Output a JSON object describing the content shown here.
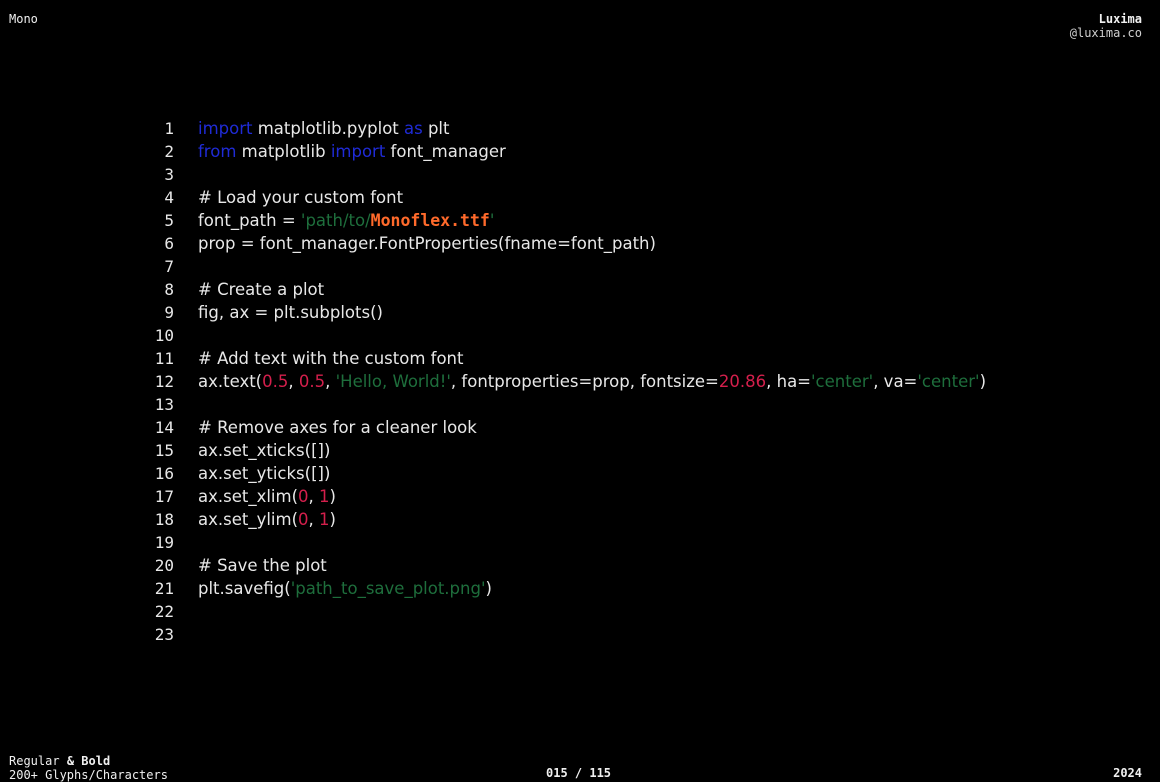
{
  "header": {
    "left": "Mono",
    "brand": "Luxima",
    "handle": "@luxima.co"
  },
  "footer": {
    "weights_regular": "Regular",
    "weights_amp": "&",
    "weights_bold": "Bold",
    "glyphs": "200+ Glyphs/Characters",
    "page": "015 / 115",
    "year": "2024"
  },
  "colors": {
    "background": "#000000",
    "keyword": "#1f2bd6",
    "string": "#1e6e3c",
    "number": "#d41f4c",
    "highlight": "#ff6a2b"
  },
  "code": [
    {
      "n": "1",
      "tokens": [
        {
          "t": "import",
          "k": "keyword"
        },
        {
          "t": " matplotlib.pyplot ",
          "k": "plain"
        },
        {
          "t": "as",
          "k": "keyword"
        },
        {
          "t": " plt",
          "k": "plain"
        }
      ]
    },
    {
      "n": "2",
      "tokens": [
        {
          "t": "from",
          "k": "keyword"
        },
        {
          "t": " matplotlib ",
          "k": "plain"
        },
        {
          "t": "import",
          "k": "keyword"
        },
        {
          "t": " font_manager",
          "k": "plain"
        }
      ]
    },
    {
      "n": "3",
      "tokens": []
    },
    {
      "n": "4",
      "tokens": [
        {
          "t": "# Load your custom font",
          "k": "comment"
        }
      ]
    },
    {
      "n": "5",
      "tokens": [
        {
          "t": "font_path = ",
          "k": "plain"
        },
        {
          "t": "'path/to/",
          "k": "string"
        },
        {
          "t": "Monoflex.ttf",
          "k": "highlight"
        },
        {
          "t": "'",
          "k": "string"
        }
      ]
    },
    {
      "n": "6",
      "tokens": [
        {
          "t": "prop = font_manager.FontProperties(fname=font_path)",
          "k": "plain"
        }
      ]
    },
    {
      "n": "7",
      "tokens": []
    },
    {
      "n": "8",
      "tokens": [
        {
          "t": "# Create a plot",
          "k": "comment"
        }
      ]
    },
    {
      "n": "9",
      "tokens": [
        {
          "t": "fig, ax = plt.subplots()",
          "k": "plain"
        }
      ]
    },
    {
      "n": "10",
      "tokens": []
    },
    {
      "n": "11",
      "tokens": [
        {
          "t": "# Add text with the custom font",
          "k": "comment"
        }
      ]
    },
    {
      "n": "12",
      "tokens": [
        {
          "t": "ax.text(",
          "k": "plain"
        },
        {
          "t": "0.5",
          "k": "number"
        },
        {
          "t": ", ",
          "k": "plain"
        },
        {
          "t": "0.5",
          "k": "number"
        },
        {
          "t": ", ",
          "k": "plain"
        },
        {
          "t": "'Hello, World!'",
          "k": "string"
        },
        {
          "t": ", fontproperties=prop, fontsize=",
          "k": "plain"
        },
        {
          "t": "20.86",
          "k": "number"
        },
        {
          "t": ", ha=",
          "k": "plain"
        },
        {
          "t": "'center'",
          "k": "string"
        },
        {
          "t": ", va=",
          "k": "plain"
        },
        {
          "t": "'center'",
          "k": "string"
        },
        {
          "t": ")",
          "k": "plain"
        }
      ]
    },
    {
      "n": "13",
      "tokens": []
    },
    {
      "n": "14",
      "tokens": [
        {
          "t": "# Remove axes for a cleaner look",
          "k": "comment"
        }
      ]
    },
    {
      "n": "15",
      "tokens": [
        {
          "t": "ax.set_xticks([])",
          "k": "plain"
        }
      ]
    },
    {
      "n": "16",
      "tokens": [
        {
          "t": "ax.set_yticks([])",
          "k": "plain"
        }
      ]
    },
    {
      "n": "17",
      "tokens": [
        {
          "t": "ax.set_xlim(",
          "k": "plain"
        },
        {
          "t": "0",
          "k": "number"
        },
        {
          "t": ", ",
          "k": "plain"
        },
        {
          "t": "1",
          "k": "number"
        },
        {
          "t": ")",
          "k": "plain"
        }
      ]
    },
    {
      "n": "18",
      "tokens": [
        {
          "t": "ax.set_ylim(",
          "k": "plain"
        },
        {
          "t": "0",
          "k": "number"
        },
        {
          "t": ", ",
          "k": "plain"
        },
        {
          "t": "1",
          "k": "number"
        },
        {
          "t": ")",
          "k": "plain"
        }
      ]
    },
    {
      "n": "19",
      "tokens": []
    },
    {
      "n": "20",
      "tokens": [
        {
          "t": "# Save the plot",
          "k": "comment"
        }
      ]
    },
    {
      "n": "21",
      "tokens": [
        {
          "t": "plt.savefig(",
          "k": "plain"
        },
        {
          "t": "'path_to_save_plot.png'",
          "k": "string"
        },
        {
          "t": ")",
          "k": "plain"
        }
      ]
    },
    {
      "n": "22",
      "tokens": []
    },
    {
      "n": "23",
      "tokens": []
    }
  ]
}
